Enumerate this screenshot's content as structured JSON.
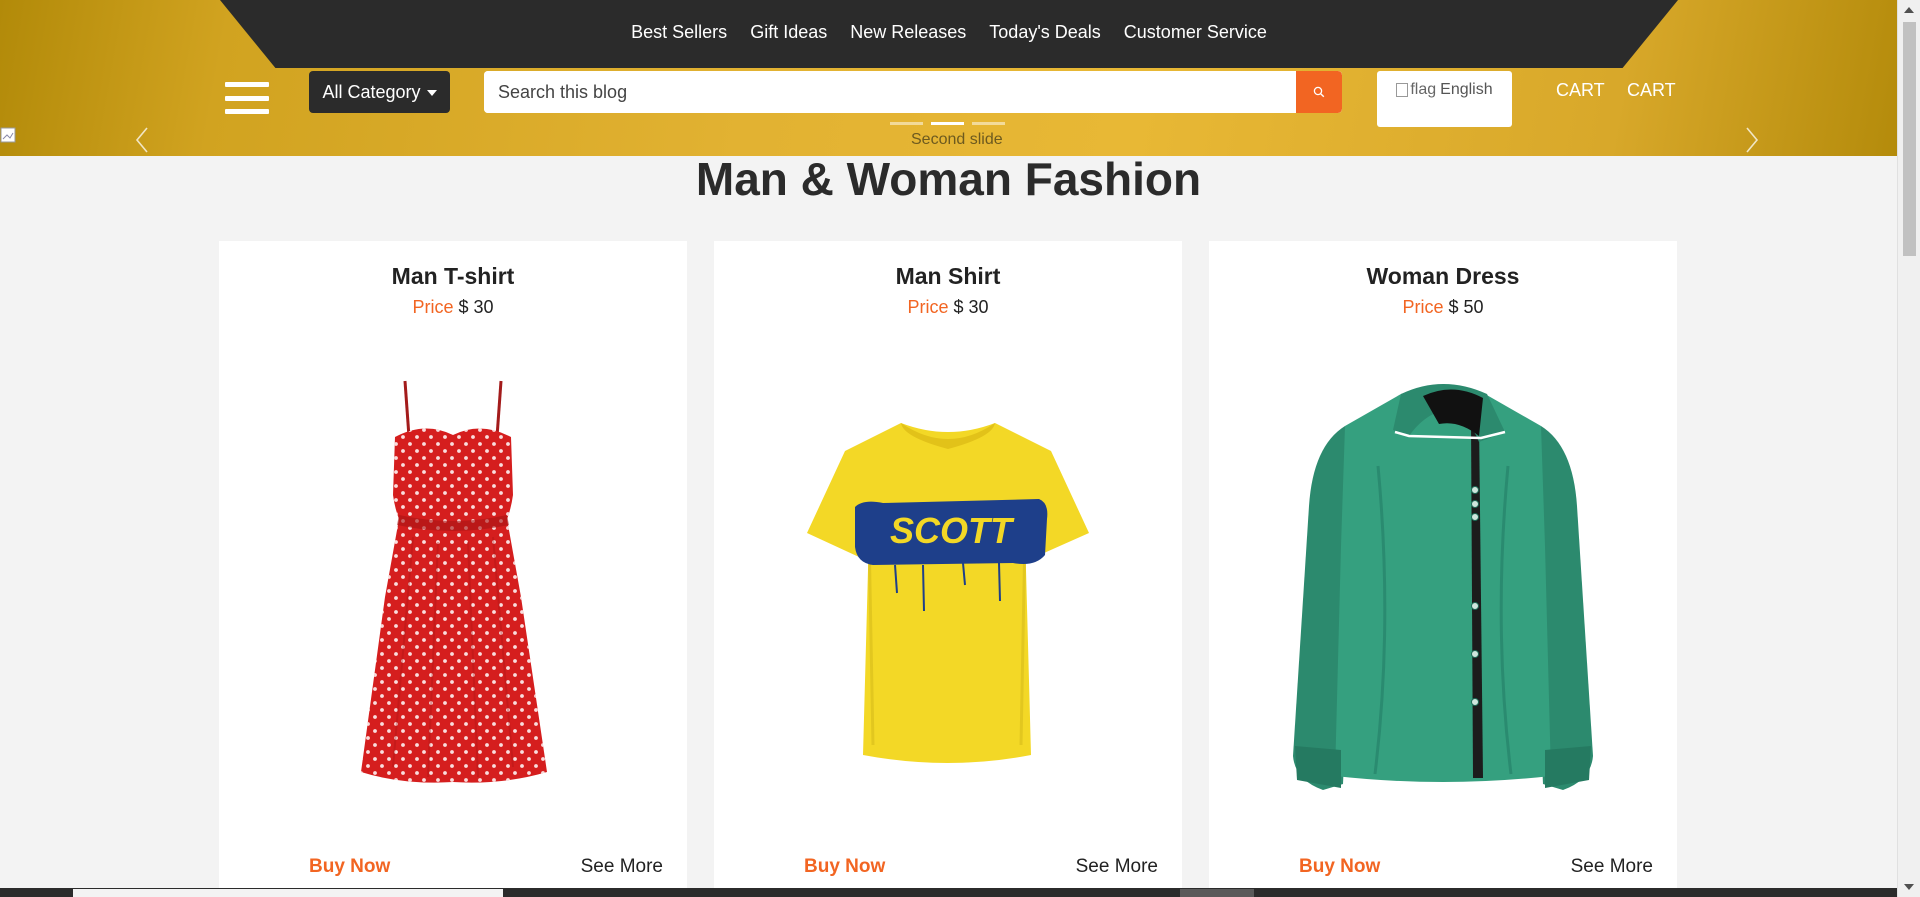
{
  "topnav": {
    "items": [
      "Best Sellers",
      "Gift Ideas",
      "New Releases",
      "Today's Deals",
      "Customer Service"
    ]
  },
  "header": {
    "category_label": "All Category",
    "search_placeholder": "Search this blog",
    "language_label": "English",
    "flag_alt": "flag",
    "cart_labels": [
      "CART",
      "CART"
    ]
  },
  "carousel": {
    "caption": "Second slide",
    "indicator_count": 3,
    "active_index": 1
  },
  "section": {
    "title": "Man & Woman Fashion"
  },
  "products": [
    {
      "title": "Man T-shirt",
      "price_label": "Price",
      "price": "$ 30",
      "buy_label": "Buy Now",
      "more_label": "See More",
      "image": "red-polka-dot-dress"
    },
    {
      "title": "Man Shirt",
      "price_label": "Price",
      "price": "$ 30",
      "buy_label": "Buy Now",
      "more_label": "See More",
      "image": "yellow-scott-tshirt"
    },
    {
      "title": "Woman Dress",
      "price_label": "Price",
      "price": "$ 50",
      "buy_label": "Buy Now",
      "more_label": "See More",
      "image": "green-dress-shirt"
    }
  ],
  "tshirt_brand_text": "SCOTT",
  "colors": {
    "accent": "#f26522",
    "dark": "#2b2b2b",
    "hero_gold": "#e2b232"
  }
}
